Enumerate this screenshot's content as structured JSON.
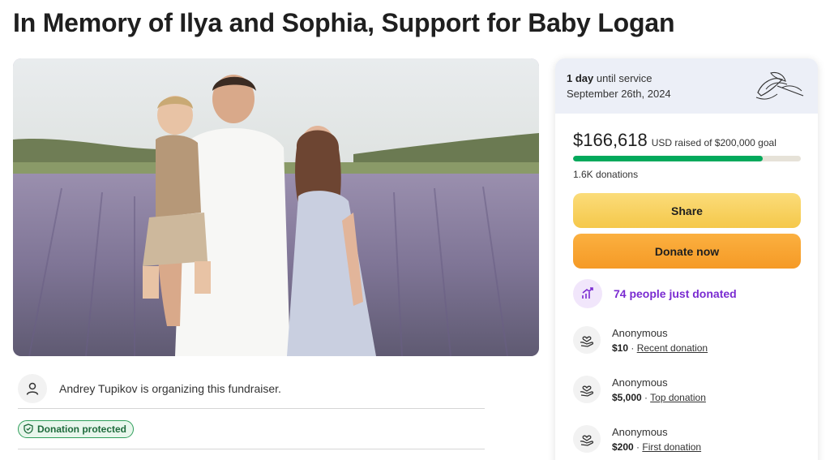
{
  "page": {
    "title": "In Memory of Ilya and Sophia, Support for Baby Logan"
  },
  "hero": {
    "image_icon": "family-photo"
  },
  "organizer": {
    "text": "Andrey Tupikov is organizing this fundraiser.",
    "icon": "person-icon"
  },
  "protection": {
    "badge_label": "Donation protected",
    "icon": "shield-icon"
  },
  "service": {
    "days_bold": "1 day",
    "days_rest": "until service",
    "date": "September 26th, 2024",
    "icon": "lily-icon"
  },
  "fundraiser": {
    "raised": "$166,618",
    "raised_rest": "USD raised of $200,000 goal",
    "progress_fraction": 0.833,
    "donations": "1.6K donations",
    "colors": {
      "progress": "#02a95c",
      "track": "#e6e2d8"
    }
  },
  "buttons": {
    "share": "Share",
    "donate": "Donate now"
  },
  "recent_activity": {
    "text": "74 people just donated",
    "icon": "trending-up-icon",
    "color": "#7a2bd1"
  },
  "donors": [
    {
      "name": "Anonymous",
      "amount": "$10",
      "sep": " · ",
      "tag": "Recent donation"
    },
    {
      "name": "Anonymous",
      "amount": "$5,000",
      "sep": " · ",
      "tag": "Top donation"
    },
    {
      "name": "Anonymous",
      "amount": "$200",
      "sep": " · ",
      "tag": "First donation"
    }
  ]
}
